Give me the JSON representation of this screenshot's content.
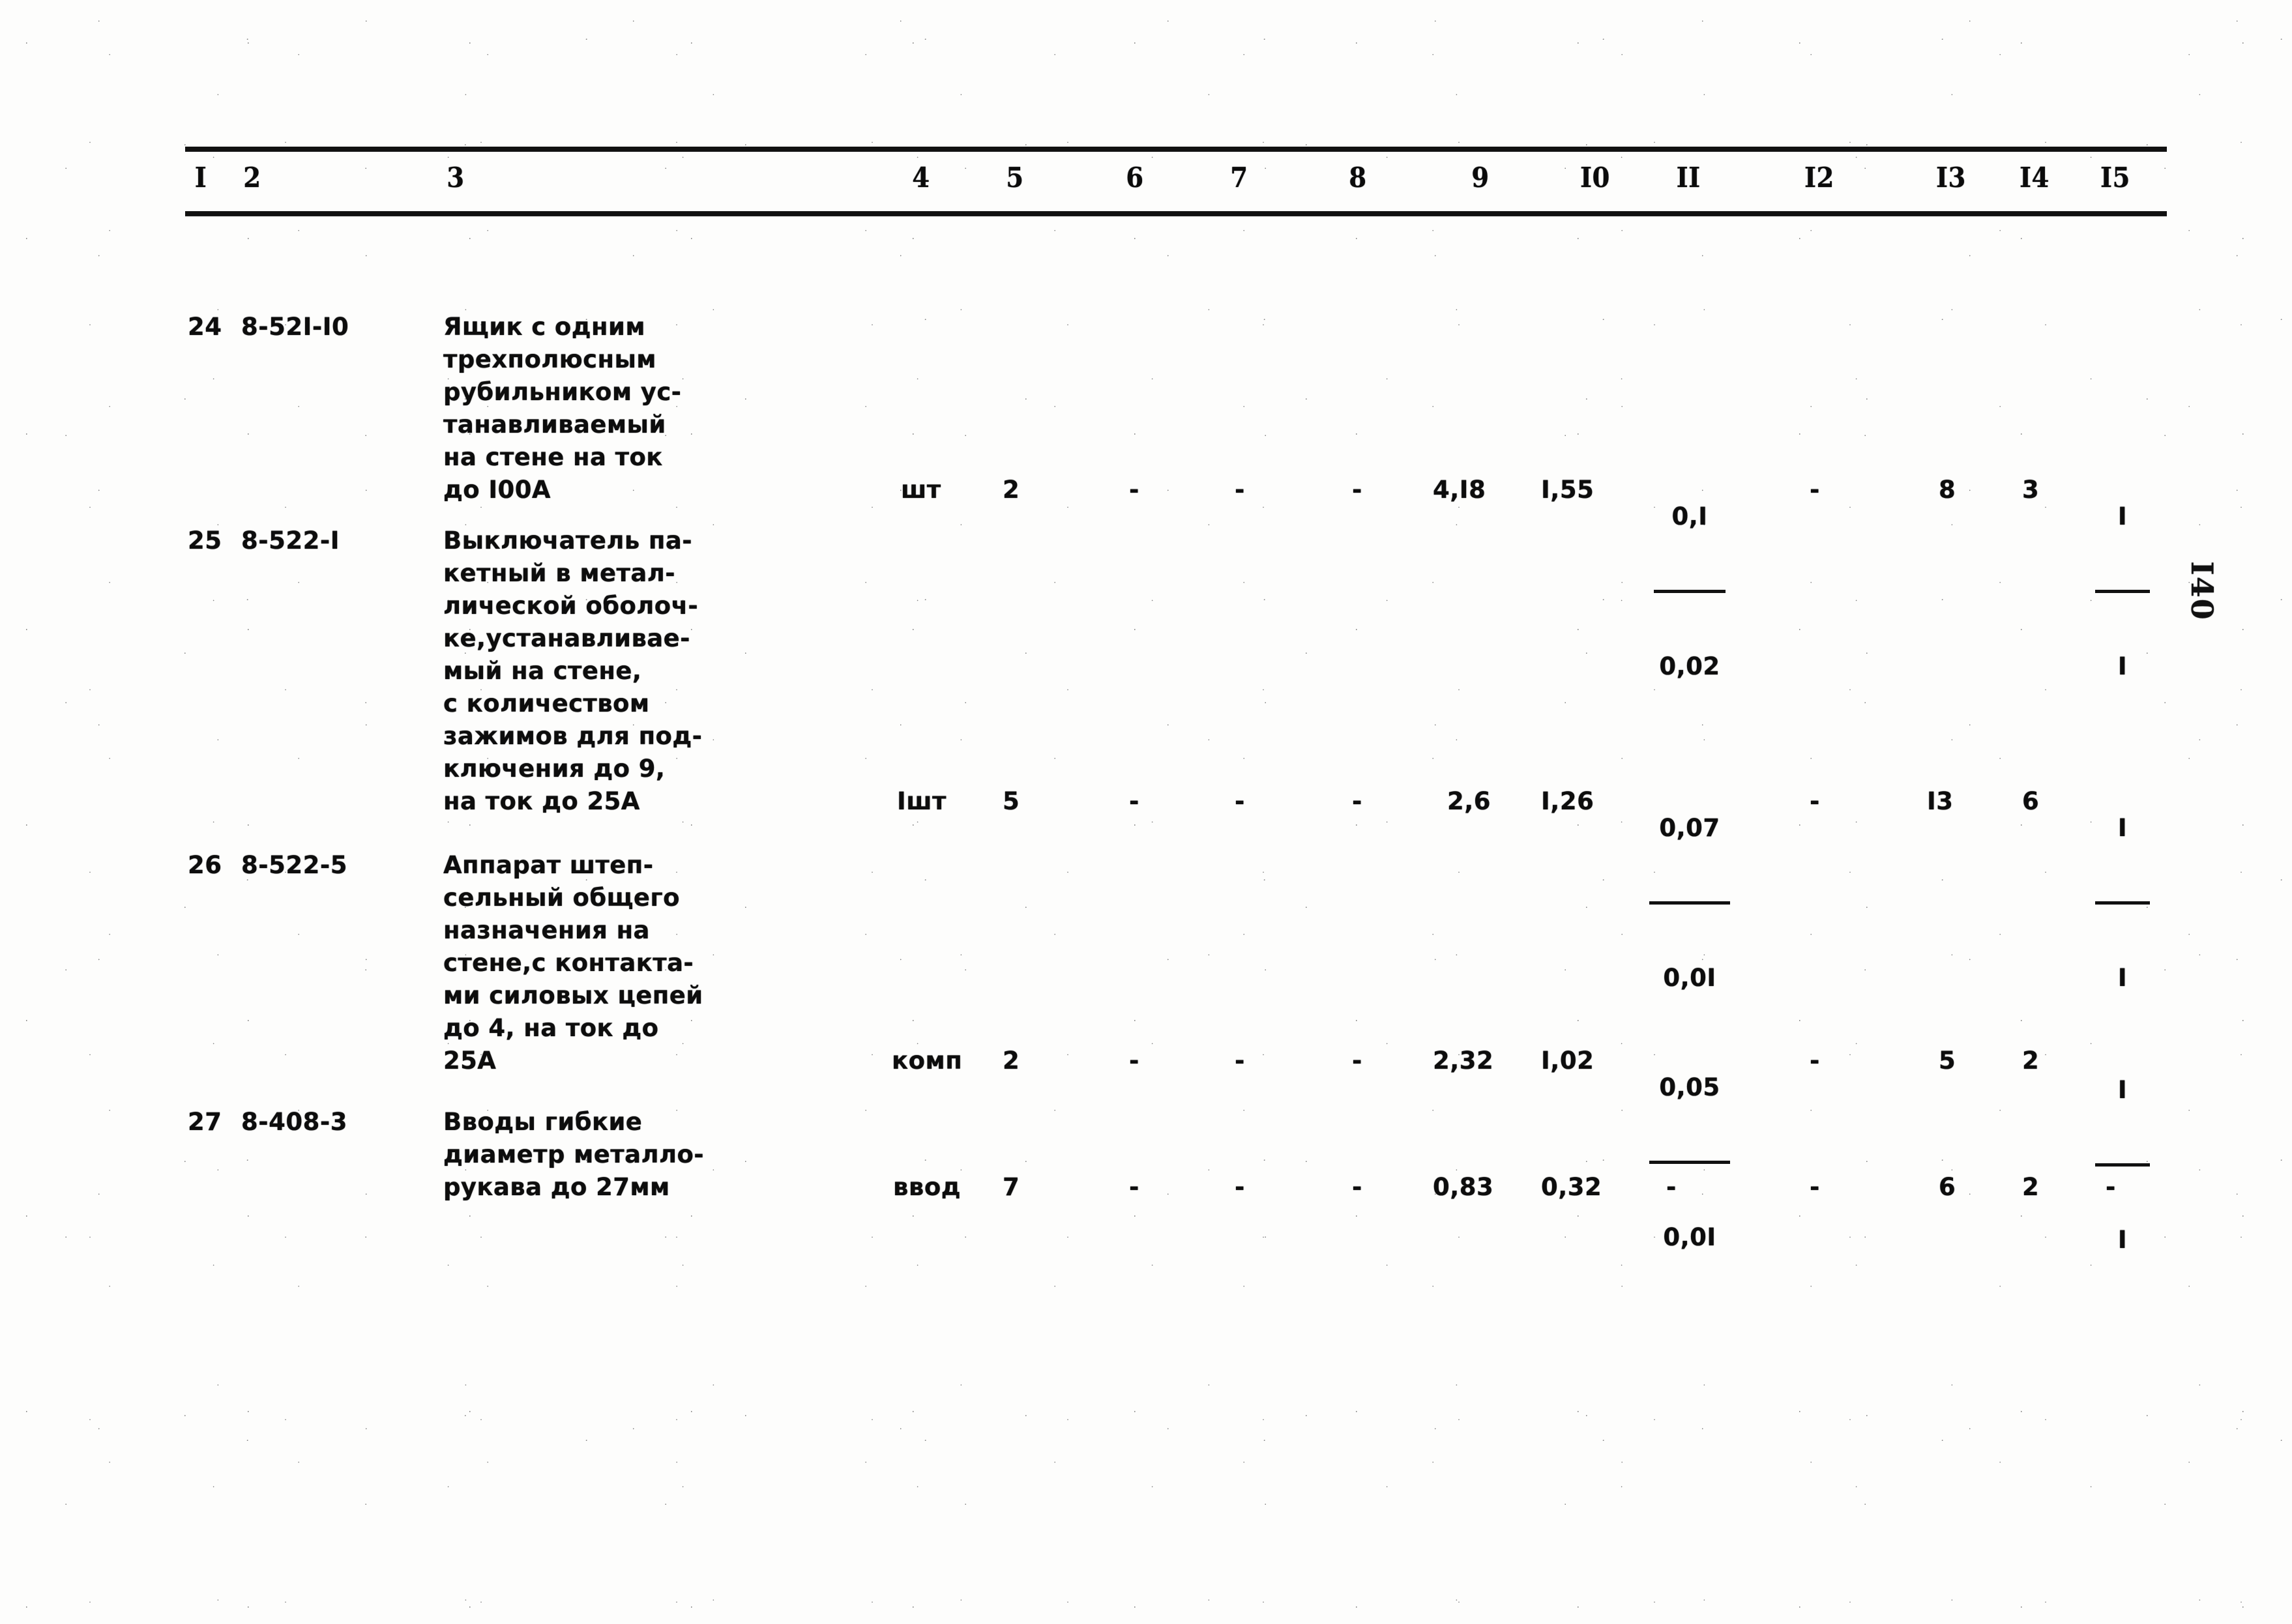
{
  "document": {
    "folio": "I40",
    "type": "technical-norms-table"
  },
  "table": {
    "headers": [
      "I",
      "2",
      "3",
      "4",
      "5",
      "6",
      "7",
      "8",
      "9",
      "I0",
      "II",
      "I2",
      "I3",
      "I4",
      "I5"
    ],
    "rows": [
      {
        "num": "24",
        "code": "8-52I-I0",
        "description": [
          "Ящик с одним",
          "трехполюсным",
          "рубильником ус-",
          "танавливаемый",
          "на стене на ток",
          "до I00A"
        ],
        "unit": "шт",
        "qty": "2",
        "c6": "-",
        "c7": "-",
        "c8": "-",
        "c9": "4,I8",
        "c10": "I,55",
        "c11_num": "0,I",
        "c11_den": "0,02",
        "c12": "-",
        "c13": "8",
        "c14": "3",
        "c15_num": "I",
        "c15_den": "I"
      },
      {
        "num": "25",
        "code": "8-522-I",
        "description": [
          "Выключатель па-",
          "кетный в метал-",
          "лической оболоч-",
          "ке,устанавливае-",
          "мый на стене,",
          "с количеством",
          "зажимов для под-",
          "ключения до 9,",
          "на ток до 25А"
        ],
        "unit": "Iшт",
        "qty": "5",
        "c6": "-",
        "c7": "-",
        "c8": "-",
        "c9": "2,6",
        "c10": "I,26",
        "c11_num": "0,07",
        "c11_den": "0,0I",
        "c12": "-",
        "c13": "I3",
        "c14": "6",
        "c15_num": "I",
        "c15_den": "I"
      },
      {
        "num": "26",
        "code": "8-522-5",
        "description": [
          "Аппарат штеп-",
          "сельный общего",
          "назначения на",
          "стене,с контакта-",
          "ми силовых цепей",
          "до 4, на ток до",
          "25А"
        ],
        "unit": "комп",
        "qty": "2",
        "c6": "-",
        "c7": "-",
        "c8": "-",
        "c9": "2,32",
        "c10": "I,02",
        "c11_num": "0,05",
        "c11_den": "0,0I",
        "c12": "-",
        "c13": "5",
        "c14": "2",
        "c15_num": "I",
        "c15_den": "I"
      },
      {
        "num": "27",
        "code": "8-408-3",
        "description": [
          "Вводы гибкие",
          "диаметр металло-",
          "рукава до 27мм"
        ],
        "unit": "ввод",
        "qty": "7",
        "c6": "-",
        "c7": "-",
        "c8": "-",
        "c9": "0,83",
        "c10": "0,32",
        "c11_num": "-",
        "c11_den": "",
        "c12": "-",
        "c13": "6",
        "c14": "2",
        "c15_num": "-",
        "c15_den": ""
      }
    ]
  }
}
